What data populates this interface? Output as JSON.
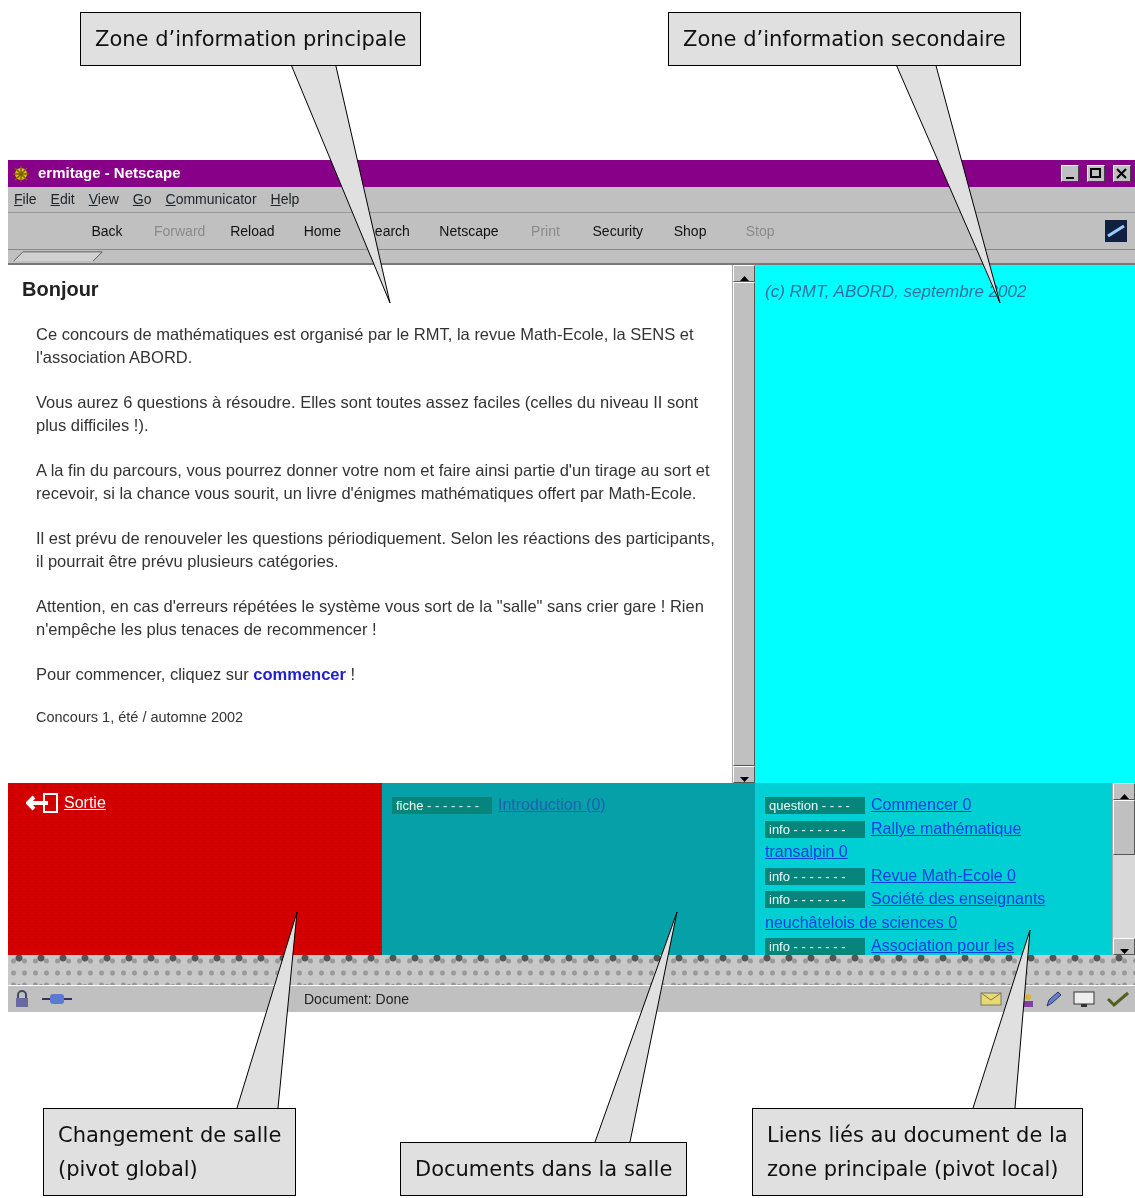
{
  "callouts_top": [
    "Zone d’information principale",
    "Zone d’information secondaire"
  ],
  "callouts_bottom": [
    "Changement de salle\n(pivot global)",
    "Documents dans la salle",
    "Liens liés au document de la\nzone principale (pivot local)"
  ],
  "window": {
    "title": "ermitage - Netscape"
  },
  "menu": [
    "File",
    "Edit",
    "View",
    "Go",
    "Communicator",
    "Help"
  ],
  "toolbar": [
    {
      "label": "Back",
      "disabled": false
    },
    {
      "label": "Forward",
      "disabled": true
    },
    {
      "label": "Reload",
      "disabled": false
    },
    {
      "label": "Home",
      "disabled": false
    },
    {
      "label": "earch",
      "disabled": false
    },
    {
      "label": "Netscape",
      "disabled": false
    },
    {
      "label": "Print",
      "disabled": true
    },
    {
      "label": "Security",
      "disabled": false
    },
    {
      "label": "Shop",
      "disabled": false
    },
    {
      "label": "Stop",
      "disabled": true
    }
  ],
  "main_frame": {
    "heading": "Bonjour",
    "paragraphs": [
      "Ce concours de mathématiques est organisé par le RMT, la revue Math-Ecole, la SENS et l'association ABORD.",
      "Vous aurez 6 questions à résoudre. Elles sont toutes assez faciles (celles du niveau II sont plus difficiles !).",
      "A la fin du parcours, vous pourrez donner votre nom et faire ainsi partie d'un tirage au sort et recevoir, si la chance vous sourit, un livre d'énigmes mathématiques offert par Math-Ecole.",
      "Il est prévu de renouveler les questions périodiquement. Selon les réactions des participants, il pourrait être prévu plusieurs catégories.",
      "Attention, en cas d'erreurs répétées le système vous sort de la \"salle\" sans crier gare ! Rien n'empêche les plus tenaces de recommencer !"
    ],
    "start": {
      "before": "Pour commencer, cliquez sur ",
      "link": "commencer",
      "after": " !"
    },
    "footer": "Concours 1, été / automne 2002"
  },
  "secondary_frame": {
    "text": "(c) RMT, ABORD, septembre 2002"
  },
  "room_frame": {
    "exit_link": "Sortie"
  },
  "documents_frame": {
    "items": [
      {
        "tag": "fiche - - - - - - -",
        "link": "Introduction (0)"
      }
    ]
  },
  "links_frame": {
    "items": [
      {
        "tag": "question - - - -",
        "link_lines": [
          "Commencer 0"
        ]
      },
      {
        "tag": "info - - - - - - -",
        "link_lines": [
          "Rallye mathématique",
          "transalpin 0"
        ]
      },
      {
        "tag": "info - - - - - - -",
        "link_lines": [
          "Revue Math-Ecole 0"
        ]
      },
      {
        "tag": "info - - - - - - -",
        "link_lines": [
          "Société des enseignants",
          "neuchâtelois de sciences 0"
        ]
      },
      {
        "tag": "info - - - - - - -",
        "link_lines": [
          "Association pour les"
        ]
      }
    ]
  },
  "status_bar": {
    "text": "Document: Done"
  }
}
